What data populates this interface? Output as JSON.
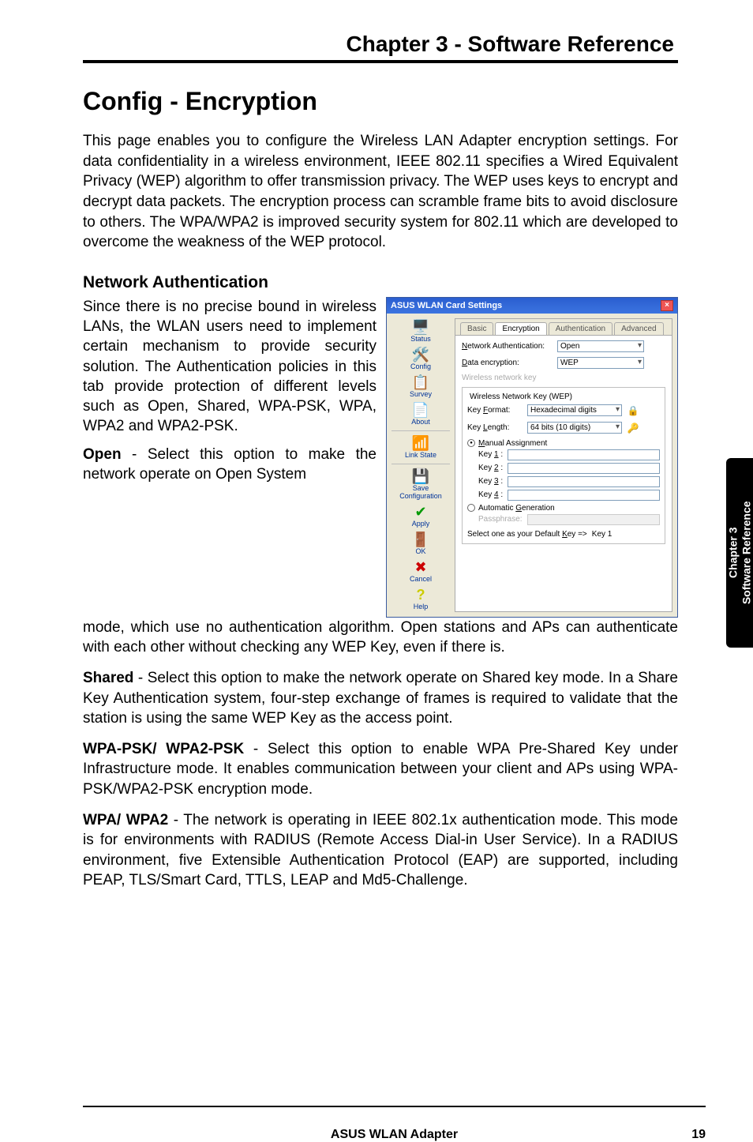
{
  "chapterHeader": "Chapter 3 - Software Reference",
  "h1": "Config - Encryption",
  "intro": "This page enables you to configure the Wireless LAN Adapter encryption settings. For data confidentiality in a wireless environment, IEEE 802.11 specifies a Wired Equivalent Privacy (WEP) algorithm to offer transmission privacy. The WEP uses keys to encrypt and decrypt data packets. The encryption process can scramble frame bits to avoid disclosure to others. The WPA/WPA2  is improved security system for 802.11 which are developed to overcome the weakness of the WEP protocol.",
  "sectionTitle": "Network Authentication",
  "leftPara1": "Since there is no precise bound in wireless LANs, the WLAN users need to implement certain mechanism to provide security solution. The Authentication policies in this tab provide protection of different levels such as Open, Shared, WPA-PSK, WPA, WPA2 and WPA2-PSK.",
  "openLabel": "Open",
  "openPara": " - Select this option to make the network operate on Open System mode, which use no authentication algorithm. Open stations and APs can authenticate with each other without checking any WEP Key, even if there is.",
  "sharedLabel": "Shared",
  "sharedPara": " - Select this option to make the network operate on Shared key mode. In a Share Key Authentication system, four-step exchange of frames is required to validate that the station is using the same WEP Key as the access point.",
  "wpapskLabel": "WPA-PSK/ WPA2-PSK",
  "wpapskPara": " - Select this option to enable WPA Pre-Shared Key under Infrastructure mode. It enables communication between your client and APs using WPA-PSK/WPA2-PSK encryption mode.",
  "wpaLabel": "WPA/ WPA2",
  "wpaPara": " - The network is operating in IEEE 802.1x authentication mode. This mode is for environments with RADIUS (Remote Access Dial-in User Service). In a RADIUS environment, five Extensible Authentication Protocol (EAP) are supported, including PEAP, TLS/Smart Card, TTLS, LEAP and Md5-Challenge.",
  "sideTab": {
    "line1": "Chapter 3",
    "line2": "Software Reference"
  },
  "footer": {
    "center": "ASUS WLAN Adapter",
    "right": "19"
  },
  "win": {
    "title": "ASUS WLAN Card Settings",
    "closeX": "×",
    "nav": {
      "status": "Status",
      "config": "Config",
      "survey": "Survey",
      "about": "About",
      "linkState": "Link State",
      "saveConfig": "Save Configuration",
      "apply": "Apply",
      "ok": "OK",
      "cancel": "Cancel",
      "help": "Help"
    },
    "tabs": {
      "basic": "Basic",
      "encryption": "Encryption",
      "authentication": "Authentication",
      "advanced": "Advanced"
    },
    "fields": {
      "networkAuthLabel": "Network Authentication:",
      "networkAuthValue": "Open",
      "dataEncLabel": "Data encryption:",
      "dataEncValue": "WEP",
      "wirelessNetKeyLabel": "Wireless network key",
      "wepLegend": "Wireless Network Key (WEP)",
      "keyFormatLabel": "Key Format:",
      "keyFormatValue": "Hexadecimal digits",
      "keyLengthLabel": "Key Length:",
      "keyLengthValue": "64 bits (10 digits)",
      "manualAssign": "Manual Assignment",
      "key1": "Key 1 :",
      "key2": "Key 2 :",
      "key3": "Key 3 :",
      "key4": "Key 4 :",
      "autoGen": "Automatic Generation",
      "passphrase": "Passphrase:",
      "selectDefault": "Select one as your Default Key =>",
      "defaultKeyValue": "Key 1"
    }
  }
}
